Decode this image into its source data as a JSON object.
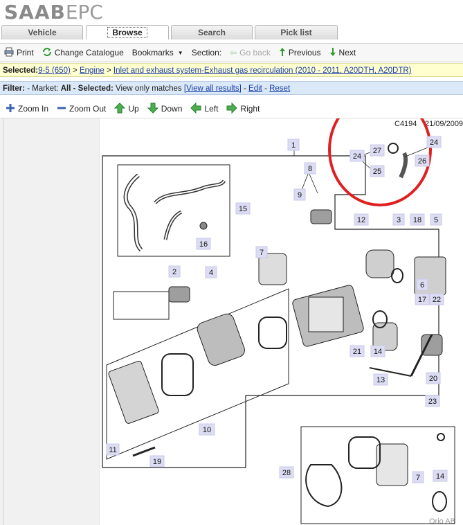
{
  "logo": {
    "brand": "SAAB",
    "suffix": "EPC"
  },
  "tabs": [
    {
      "label": "Vehicle"
    },
    {
      "label": "Browse"
    },
    {
      "label": "Search"
    },
    {
      "label": "Pick list"
    }
  ],
  "toolbar": {
    "print": "Print",
    "change_catalogue": "Change Catalogue",
    "bookmarks": "Bookmarks",
    "section": "Section:",
    "go_back": "Go back",
    "previous": "Previous",
    "next": "Next"
  },
  "selected": {
    "prefix": "Selected:",
    "model": "9-5 (650)",
    "sep": ">",
    "group": "Engine",
    "sub": "Inlet and exhaust system-Exhaust gas recirculation (2010 - 2011, A20DTH, A20DTR)"
  },
  "filter": {
    "prefix": "Filter:",
    "market_label": "- Market:",
    "market": "All",
    "selected_label": "- Selected:",
    "selected_value": "View only matches",
    "view_all": "[View all results]",
    "dash1": "-",
    "edit": "Edit",
    "dash2": "-",
    "reset": "Reset"
  },
  "zoombar": {
    "zoom_in": "Zoom In",
    "zoom_out": "Zoom Out",
    "up": "Up",
    "down": "Down",
    "left": "Left",
    "right": "Right"
  },
  "diagram": {
    "code": "C4194",
    "date": "21/09/2009",
    "copyright": "Orio AB",
    "callouts": [
      "1",
      "2",
      "3",
      "4",
      "5",
      "6",
      "7",
      "8",
      "9",
      "10",
      "11",
      "12",
      "13",
      "14",
      "15",
      "16",
      "17",
      "18",
      "19",
      "20",
      "21",
      "22",
      "23",
      "24",
      "25",
      "26",
      "27",
      "28"
    ],
    "highlight_color": "#e02020",
    "callout_color": "#dcdcf2"
  }
}
